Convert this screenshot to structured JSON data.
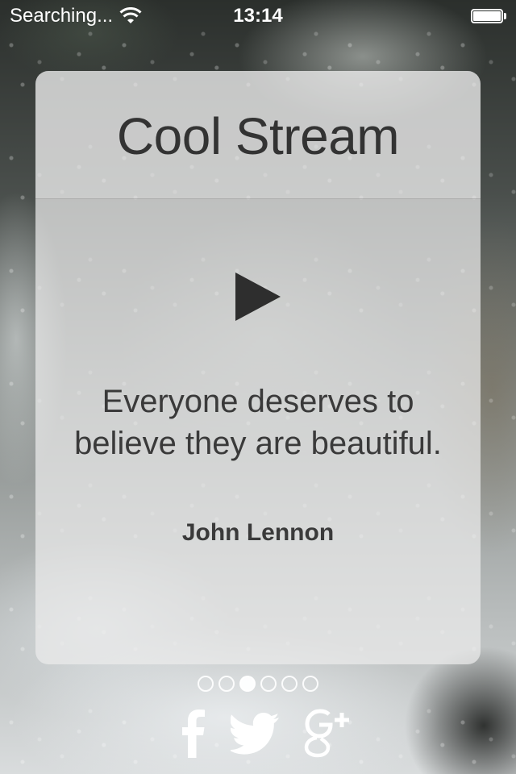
{
  "status_bar": {
    "carrier": "Searching...",
    "time": "13:14",
    "battery_level": 1.0
  },
  "card": {
    "title": "Cool Stream",
    "quote": "Everyone deserves to believe they are beautiful.",
    "author": "John Lennon",
    "play_icon": "play-icon"
  },
  "pagination": {
    "count": 6,
    "active_index": 2
  },
  "social": {
    "icons": [
      "facebook-icon",
      "twitter-icon",
      "google-plus-icon"
    ],
    "color": "#ffffff"
  },
  "colors": {
    "card_bg": "#ececec",
    "text": "#333333",
    "dot": "#ffffff"
  }
}
